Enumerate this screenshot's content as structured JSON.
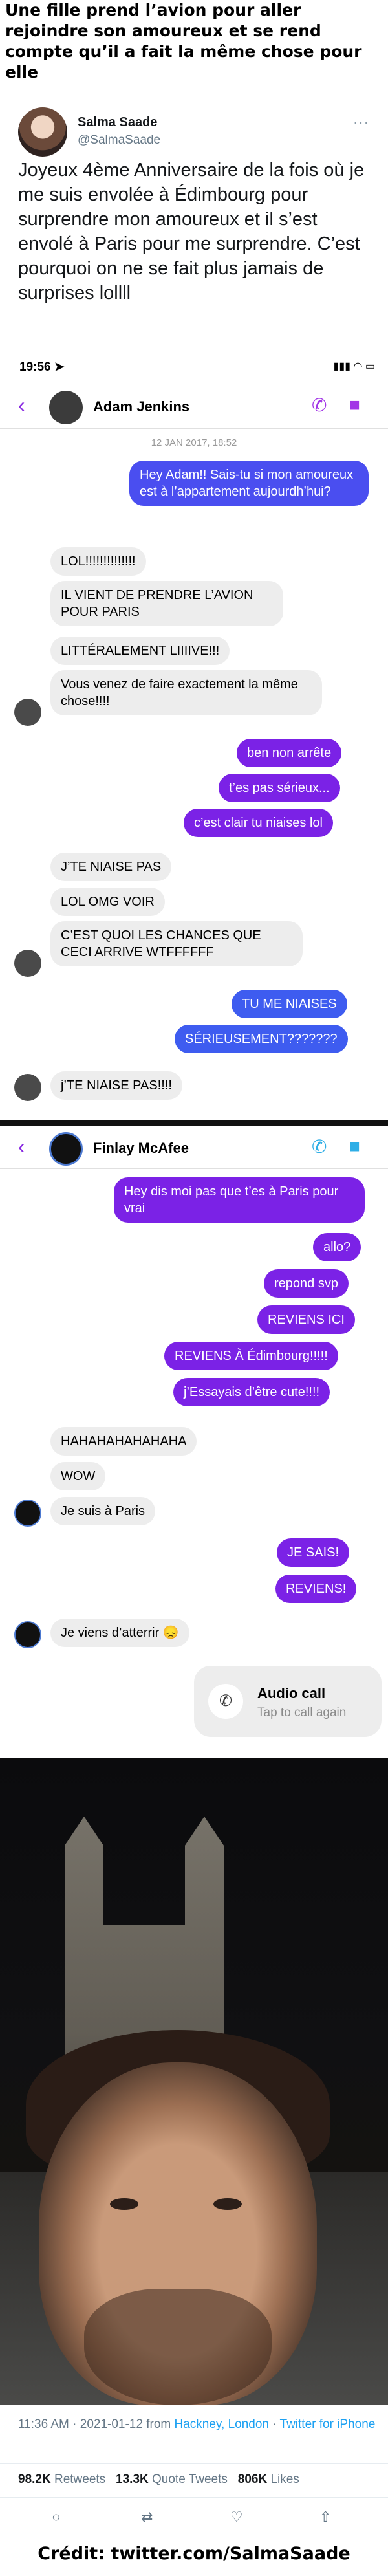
{
  "headline": "Une fille prend l’avion pour aller rejoindre son amoureux et se rend compte qu’il a fait la même chose pour elle",
  "tweet": {
    "name": "Salma Saade",
    "handle": "@SalmaSaade",
    "more": "···",
    "text": "Joyeux 4ème Anniversaire de la fois où je me suis envolée à Édimbourg pour surprendre mon amoureux et il s’est envolé à Paris pour me surprendre. C’est pourquoi on ne se fait plus jamais de surprises lollll",
    "timestamp": "11:36 AM · 2021-01-12 from ",
    "location": "Hackney, London",
    "sep": " · ",
    "client": "Twitter for iPhone",
    "retweets_count": "98.2K",
    "retweets_label": " Retweets",
    "quotes_count": "13.3K",
    "quotes_label": " Quote Tweets",
    "likes_count": "806K",
    "likes_label": " Likes",
    "actions": {
      "reply": "○",
      "retweet": "⇄",
      "like": "♡",
      "share": "⇧"
    }
  },
  "chat1": {
    "status_time": "19:56 ➤",
    "status_icons": "▮▮▮ ◠ ▭",
    "back": "‹",
    "contact": "Adam Jenkins",
    "phone_icon": "✆",
    "video_icon": "■",
    "date": "12 JAN 2017, 18:52",
    "messages": [
      "Hey Adam!! Sais-tu si mon amoureux est à l’appartement aujourdh’hui?",
      "LOL!!!!!!!!!!!!!!",
      "IL VIENT DE PRENDRE L’AVION POUR PARIS",
      "LITTÉRALEMENT LIIIIVE!!!",
      "Vous venez de faire exactement la même chose!!!!",
      "ben non arrête",
      "t’es pas sérieux...",
      "c’est clair tu niaises lol",
      "J’TE NIAISE PAS",
      "LOL OMG VOIR",
      "C’EST QUOI LES CHANCES QUE CECI ARRIVE WTFFFFFF",
      "TU ME NIAISES",
      "SÉRIEUSEMENT???????",
      "j’TE NIAISE PAS!!!!"
    ]
  },
  "chat2": {
    "back": "‹",
    "contact": "Finlay McAfee",
    "phone_icon": "✆",
    "video_icon": "■",
    "messages": [
      "Hey dis moi pas que t’es à Paris pour vrai",
      "allo?",
      "repond svp",
      "REVIENS ICI",
      "REVIENS À Édimbourg!!!!!",
      "j’Essayais d’être cute!!!!",
      "HAHAHAHAHAHAHA",
      "WOW",
      "Je suis à Paris",
      "JE SAIS!",
      "REVIENS!",
      "Je viens d’atterrir 😞"
    ],
    "call_icon": "✆",
    "call_title": "Audio call",
    "call_sub": "Tap to call again"
  },
  "credit": "Crédit: twitter.com/SalmaSaade"
}
